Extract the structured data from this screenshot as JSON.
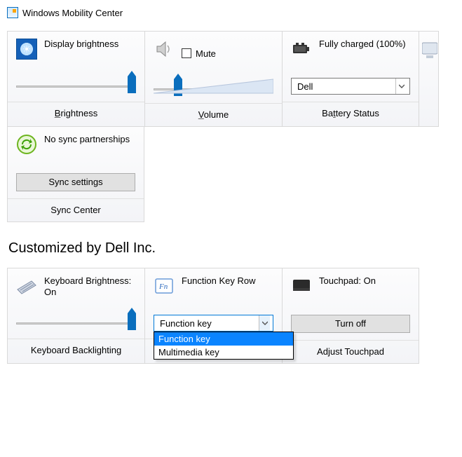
{
  "window": {
    "title": "Windows Mobility Center"
  },
  "row1": {
    "brightness": {
      "label": "Display brightness",
      "footer_pre": "B",
      "footer_post": "rightness",
      "value_pct": 100
    },
    "volume": {
      "mute_pre": "M",
      "mute_post": "ute",
      "footer_pre": "V",
      "footer_post": "olume",
      "value_pct": 17
    },
    "battery": {
      "label": "Fully charged (100%)",
      "select_value": "Dell",
      "footer_pre": "Ba",
      "footer_ul": "t",
      "footer_post": "tery Status"
    }
  },
  "row2": {
    "sync": {
      "label": "No sync partnerships",
      "button": "Sync settings",
      "button_ul": "S",
      "footer": "Sync Center"
    }
  },
  "section": "Customized by Dell Inc.",
  "row3": {
    "keyboard": {
      "label": "Keyboard Brightness: On",
      "footer": "Keyboard Backlighting",
      "value_pct": 100
    },
    "fnrow": {
      "label": "Function Key Row",
      "select_value": "Function key",
      "options": [
        "Function key",
        "Multimedia key"
      ]
    },
    "touchpad": {
      "label": "Touchpad: On",
      "button": "Turn off",
      "footer": "Adjust Touchpad"
    }
  }
}
